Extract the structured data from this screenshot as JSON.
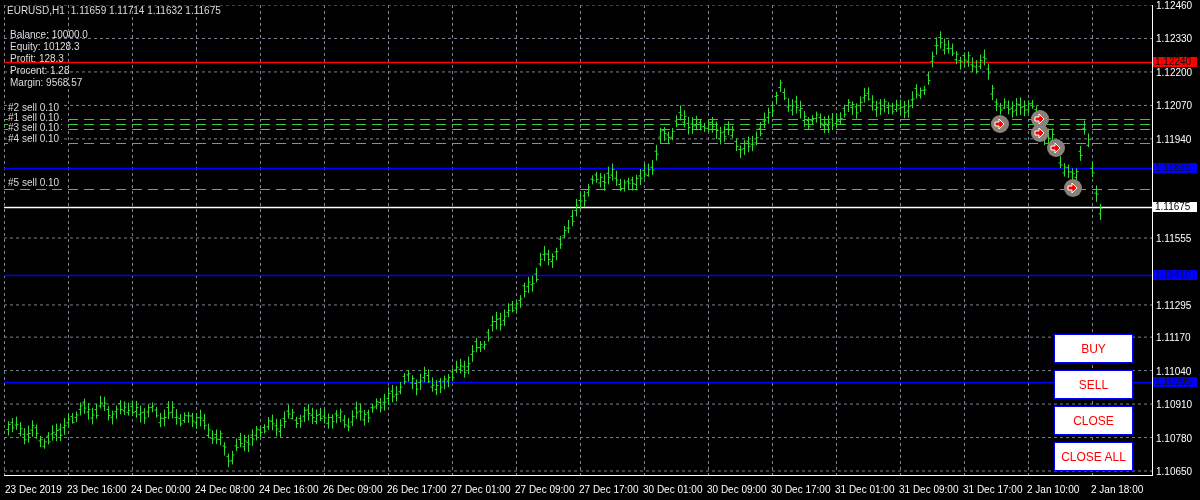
{
  "header": {
    "symbol": "EURUSD,H1",
    "prices": "1.11659 1.11714 1.11632 1.11675"
  },
  "account_info": [
    "Balance: 10000.0",
    "Equity: 10128.3",
    "Profit: 128.3",
    "Procent: 1.28",
    "Margin: 9568.57"
  ],
  "orders": [
    {
      "label": "#2 sell 0.10"
    },
    {
      "label": "#1 sell 0.10"
    },
    {
      "label": "#3 sell 0.10"
    },
    {
      "label": "#4 sell 0.10"
    },
    {
      "label": "#5 sell 0.10"
    }
  ],
  "price_axis": [
    "1.12460",
    "1.12330",
    "1.12200",
    "1.12070",
    "1.11940",
    "1.11555",
    "1.11295",
    "1.11170",
    "1.11040",
    "1.10910",
    "1.10780",
    "1.10650"
  ],
  "price_tags": [
    {
      "text": "1.12240",
      "color": "#ff0000"
    },
    {
      "text": "1.11825",
      "color": "#0000ff"
    },
    {
      "text": "1.11675",
      "color": "#ffffff"
    },
    {
      "text": "1.11410",
      "color": "#0000ff"
    },
    {
      "text": "1.10995",
      "color": "#0000ff"
    }
  ],
  "time_axis": [
    "23 Dec 2019",
    "23 Dec 16:00",
    "24 Dec 00:00",
    "24 Dec 08:00",
    "24 Dec 16:00",
    "26 Dec 09:00",
    "26 Dec 17:00",
    "27 Dec 01:00",
    "27 Dec 09:00",
    "27 Dec 17:00",
    "30 Dec 01:00",
    "30 Dec 09:00",
    "30 Dec 17:00",
    "31 Dec 01:00",
    "31 Dec 09:00",
    "31 Dec 17:00",
    "2 Jan 10:00",
    "2 Jan 18:00"
  ],
  "buttons": [
    "BUY",
    "SELL",
    "CLOSE",
    "CLOSE ALL"
  ]
}
